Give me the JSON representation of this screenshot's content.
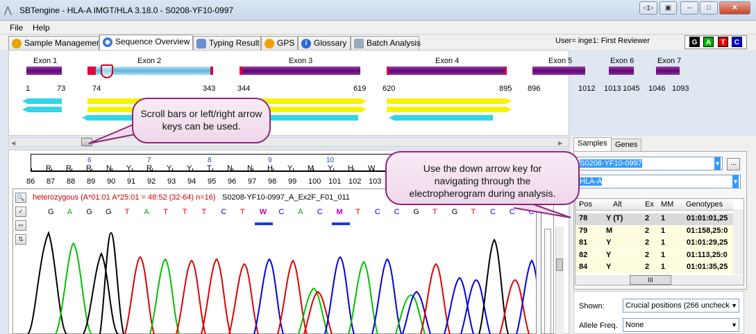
{
  "window": {
    "title": "SBTengine - HLA-A IMGT/HLA 3.18.0 - S0208-YF10-0997",
    "buttons": {
      "nav": "◁▷",
      "restore_doc": "▣",
      "minimize": "–",
      "maximize": "□",
      "close": "✕"
    }
  },
  "menu": [
    "File",
    "Help"
  ],
  "tabs": [
    "Sample Management",
    "Sequence Overview",
    "Typing Result",
    "GPS",
    "Glossary",
    "Batch Analysis"
  ],
  "user": "User= inge1: First Reviewer",
  "bases": [
    {
      "label": "G",
      "color": "#000000"
    },
    {
      "label": "A",
      "color": "#00b000"
    },
    {
      "label": "T",
      "color": "#e00000"
    },
    {
      "label": "C",
      "color": "#0000e0"
    }
  ],
  "exons": [
    {
      "label": "Exon 1",
      "start": "1",
      "end": "73"
    },
    {
      "label": "Exon 2",
      "start": "74",
      "end": "343"
    },
    {
      "label": "Exon 3",
      "start": "344",
      "end": "619"
    },
    {
      "label": "Exon 4",
      "start": "620",
      "end": "895"
    },
    {
      "label": "Exon 5",
      "start": "896",
      "end": "1012"
    },
    {
      "label": "Exon 6",
      "start": "1013",
      "end": "1045"
    },
    {
      "label": "Exon 7",
      "start": "1046",
      "end": "1093"
    }
  ],
  "ruler": {
    "codons": [
      "6",
      "7",
      "8",
      "9",
      "10"
    ],
    "codes": [
      "R",
      "R",
      "R",
      "N",
      "Y",
      "R",
      "Y",
      "Y",
      "T",
      "N",
      "N",
      "H",
      "Y",
      "M",
      "Y",
      "H",
      "W"
    ],
    "positions": [
      "86",
      "87",
      "88",
      "89",
      "90",
      "91",
      "92",
      "93",
      "94",
      "95",
      "96",
      "97",
      "98",
      "99",
      "100",
      "101",
      "102",
      "103"
    ]
  },
  "electro": {
    "heterozygous": "heterozygous (A*01:01 A*25:01 = 48:52 (32-64) n=16)",
    "sample": "S0208-YF10-0997_A_Ex2F_F01_011",
    "nucleotides": [
      "G",
      "A",
      "G",
      "G",
      "T",
      "A",
      "T",
      "T",
      "T",
      "C",
      "T",
      "W",
      "C",
      "A",
      "C",
      "M",
      "T",
      "C",
      "C",
      "G",
      "T",
      "G",
      "T",
      "C",
      "C",
      "C"
    ]
  },
  "right_panel": {
    "tabs": [
      "Samples",
      "Genes"
    ],
    "sample_select": "S0208-YF10-0997",
    "more_button": "...",
    "gene_select": "HLA-A",
    "table": {
      "headers": [
        "Pos",
        "Alt",
        "Ex",
        "MM",
        "Genotypes"
      ],
      "rows": [
        [
          "78",
          "Y (T)",
          "2",
          "1",
          "01:01:01,25"
        ],
        [
          "79",
          "M",
          "2",
          "1",
          "01:158,25:0"
        ],
        [
          "81",
          "Y",
          "2",
          "1",
          "01:01:29,25"
        ],
        [
          "82",
          "Y",
          "2",
          "1",
          "01:113,25:0"
        ],
        [
          "84",
          "Y",
          "2",
          "1",
          "01:01:35,25"
        ]
      ],
      "hscroll_grip": "III"
    },
    "shown_label": "Shown:",
    "shown_value": "Crucial positions (266 uncheck",
    "allele_label": "Allele Freq.",
    "allele_value": "None"
  },
  "callouts": {
    "scroll": "Scroll bars or left/right arrow keys can be used.",
    "down": "Use the down arrow key for navigating through the electropherogram during analysis."
  }
}
